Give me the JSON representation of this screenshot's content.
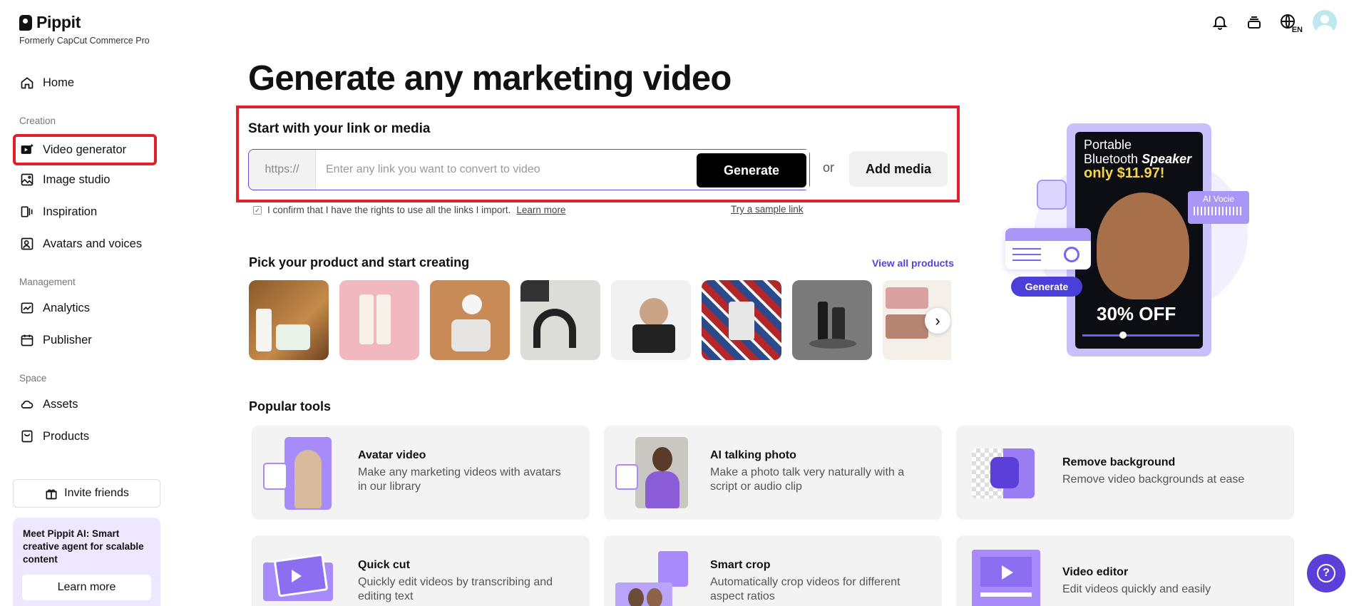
{
  "brand": {
    "name": "Pippit",
    "subtitle": "Formerly CapCut Commerce Pro"
  },
  "sidebar": {
    "home": "Home",
    "sections": {
      "creation": "Creation",
      "management": "Management",
      "space": "Space"
    },
    "creation_items": [
      {
        "label": "Video generator",
        "icon": "video-generator-icon",
        "active": true
      },
      {
        "label": "Image studio",
        "icon": "image-studio-icon"
      },
      {
        "label": "Inspiration",
        "icon": "inspiration-icon"
      },
      {
        "label": "Avatars and voices",
        "icon": "avatar-icon"
      }
    ],
    "management_items": [
      {
        "label": "Analytics",
        "icon": "analytics-icon"
      },
      {
        "label": "Publisher",
        "icon": "calendar-icon"
      }
    ],
    "space_items": [
      {
        "label": "Assets",
        "icon": "cloud-icon"
      },
      {
        "label": "Products",
        "icon": "product-box-icon"
      }
    ],
    "invite": "Invite friends",
    "promo": {
      "text_bold": "Meet Pippit AI:",
      "text_rest": " Smart creative agent for scalable content",
      "button": "Learn more"
    }
  },
  "header": {
    "icons": [
      "bell-icon",
      "stack-icon",
      "globe-language-icon",
      "user-avatar"
    ],
    "lang": "EN"
  },
  "main": {
    "headline": "Generate any marketing video",
    "start_label": "Start with your link or media",
    "url_prefix": "https://",
    "url_placeholder": "Enter any link you want to convert to video",
    "generate": "Generate",
    "or": "or",
    "add_media": "Add media",
    "confirm_text": "I confirm that I have the rights to use all the links I import.",
    "confirm_link": "Learn more",
    "sample_link": "Try a sample link",
    "pick_title": "Pick your product and start creating",
    "view_all": "View all products",
    "popular_title": "Popular tools"
  },
  "hero": {
    "line1": "Portable",
    "line1b": "Bluetooth ",
    "line1c": "Speaker",
    "price": "only $11.97!",
    "discount": "30% OFF",
    "generate": "Generate",
    "voice_tag": "AI Vocie"
  },
  "tools": [
    {
      "title": "Avatar video",
      "desc": "Make any marketing videos with avatars in our library"
    },
    {
      "title": "AI talking photo",
      "desc": "Make a photo talk very naturally with a script or audio clip"
    },
    {
      "title": "Remove background",
      "desc": "Remove video backgrounds at ease"
    },
    {
      "title": "Quick cut",
      "desc": "Quickly edit videos by transcribing and editing text"
    },
    {
      "title": "Smart crop",
      "desc": "Automatically crop videos for different aspect ratios"
    },
    {
      "title": "Video editor",
      "desc": "Edit videos quickly and easily"
    }
  ],
  "colors": {
    "accent": "#5b3fd9",
    "highlight_box": "#e0202a",
    "card_bg": "#f3f3f3"
  }
}
